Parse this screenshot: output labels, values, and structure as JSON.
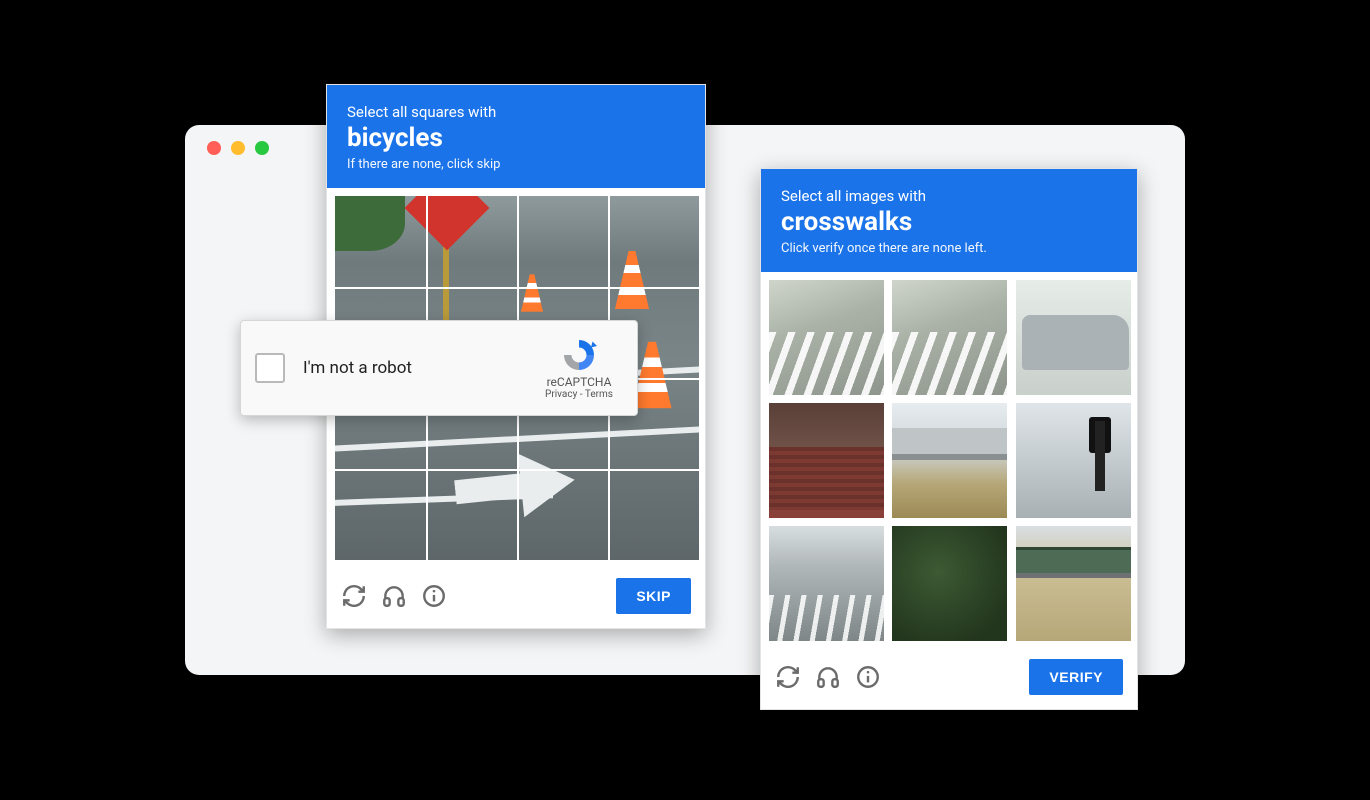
{
  "recaptcha_box": {
    "checkbox_checked": false,
    "label": "I'm not a robot",
    "brand": "reCAPTCHA",
    "privacy_label": "Privacy",
    "terms_label": "Terms",
    "links_separator": " - "
  },
  "captcha_left": {
    "line1": "Select all squares with",
    "target": "bicycles",
    "line3": "If there are none, click skip",
    "grid": {
      "rows": 4,
      "cols": 4
    },
    "button_label": "SKIP"
  },
  "captcha_right": {
    "line1": "Select all images with",
    "target": "crosswalks",
    "line3": "Click verify once there are none left.",
    "button_label": "VERIFY",
    "tiles": [
      "crosswalk",
      "crosswalk",
      "parked-car",
      "house-roof",
      "bridge",
      "traffic-signal",
      "street",
      "trees",
      "overpass"
    ]
  },
  "footer_icons": {
    "reload_title": "Get a new challenge",
    "audio_title": "Get an audio challenge",
    "info_title": "Help"
  },
  "colors": {
    "primary": "#1a73e8"
  }
}
